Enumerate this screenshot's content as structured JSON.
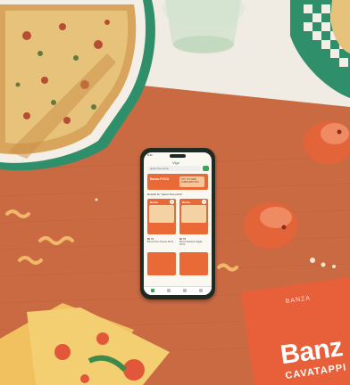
{
  "scene": {
    "description_none": "",
    "mat_color": "#c9653d",
    "background_color": "#efe9df",
    "accent_green": "#3aa65a"
  },
  "phone": {
    "status_time": "9:41",
    "app_logo": "Vigo",
    "search_placeholder": "gluten free pizza",
    "banner_left": "Banza PIZZA",
    "banner_right": "TRY IT'S NEW SUBSCRIPTION",
    "results_label": "Results for \"gluten free pizza\"",
    "products": [
      {
        "brand": "Banza",
        "price": "$6.79",
        "name": "Banza Four Cheese Pizza"
      },
      {
        "brand": "Banza",
        "price": "$6.79",
        "name": "Banza Roasted Veggie Pizza"
      }
    ],
    "tabs": [
      "home-icon",
      "search-icon",
      "cart-icon",
      "account-icon"
    ]
  },
  "box": {
    "top_text": "BANZA",
    "brand": "Banz",
    "product": "CAVATAPPI"
  }
}
